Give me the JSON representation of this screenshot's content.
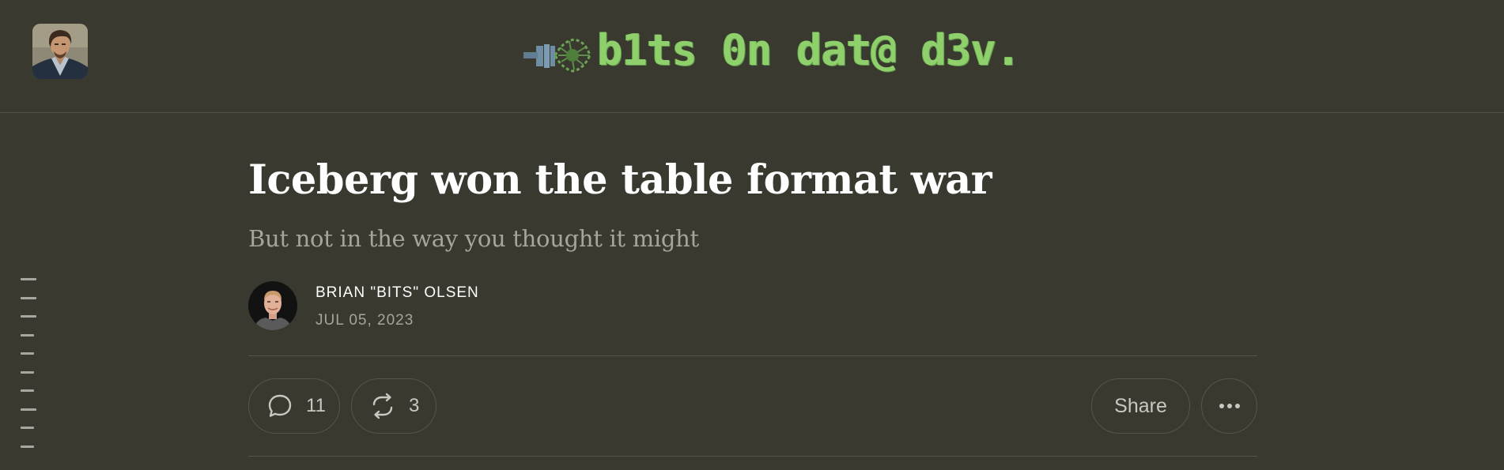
{
  "header": {
    "site_avatar": "site-author-photo",
    "logo_text": "b1ts 0n dat@ d3v."
  },
  "post": {
    "title": "Iceberg won the table format war",
    "subtitle": "But not in the way you thought it might",
    "author": "BRIAN \"BITS\" OLSEN",
    "date": "JUL 05, 2023"
  },
  "actions": {
    "comment_icon": "speech-bubble-icon",
    "comment_count": "11",
    "restack_icon": "restack-icon",
    "restack_count": "3",
    "share_label": "Share",
    "more_icon": "ellipsis-icon"
  },
  "toc": {
    "icon": "table-of-contents-icon",
    "line_count": 10
  },
  "colors": {
    "background": "#393930",
    "title": "#ffffff",
    "subtitle": "#a6a59c",
    "logo": "#8fd06c",
    "divider": "#55554b"
  }
}
